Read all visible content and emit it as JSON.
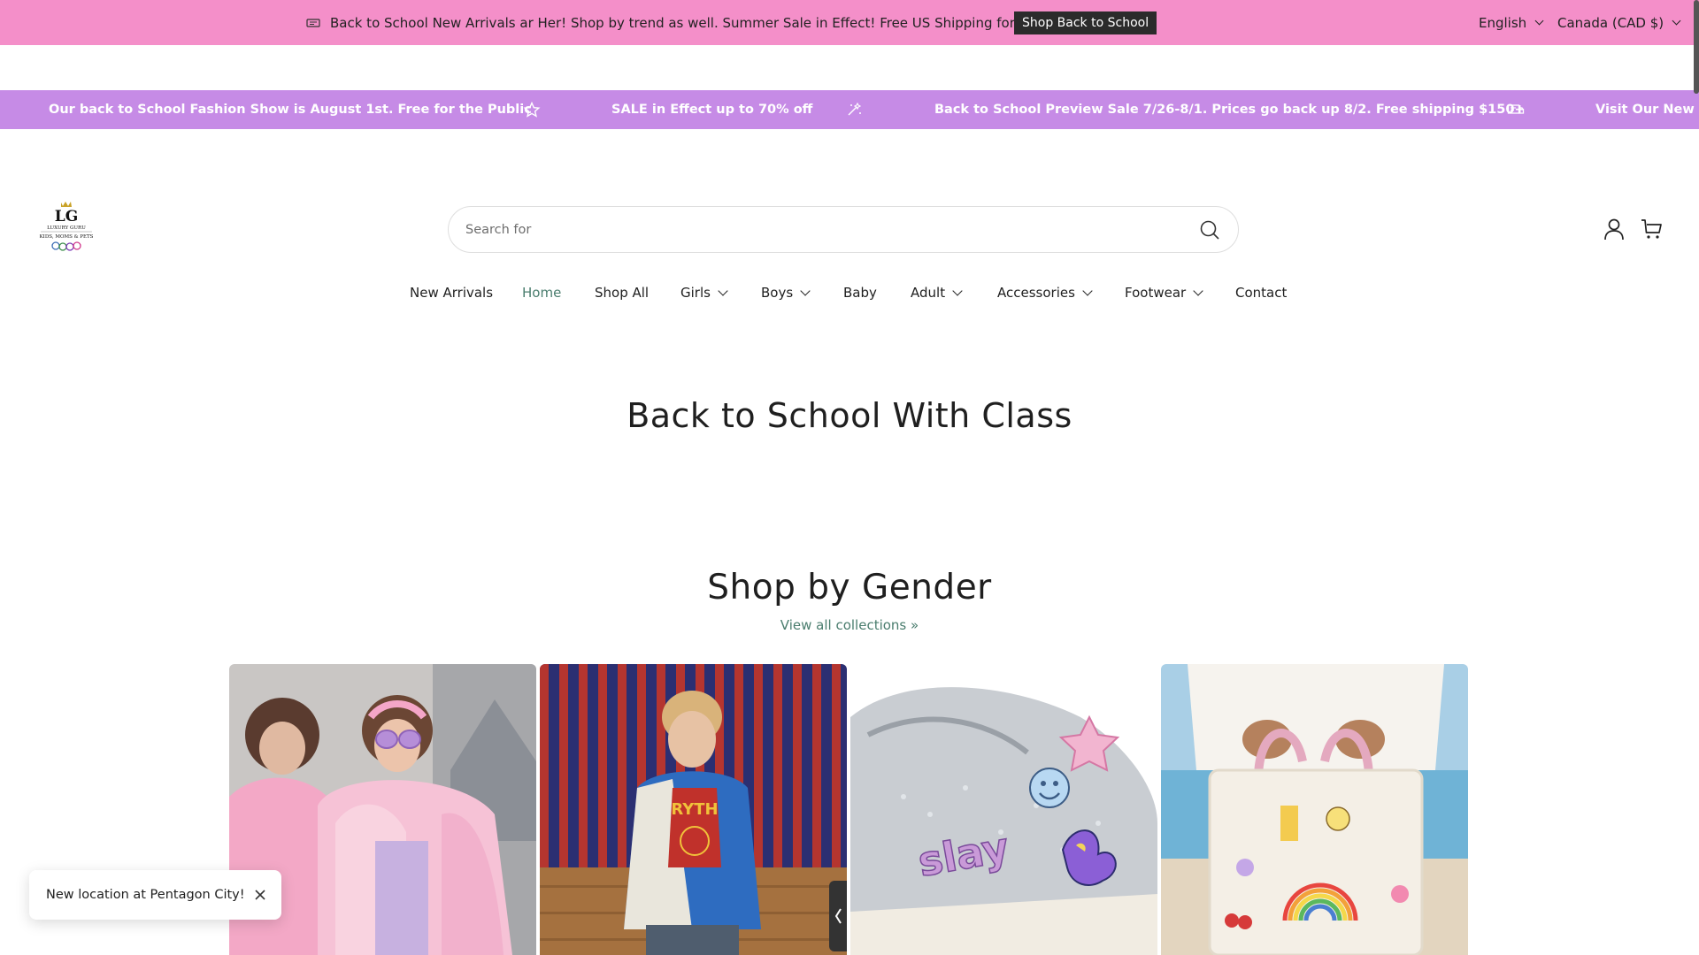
{
  "announcement": {
    "message": "Back to School New Arrivals ar Her! Shop by trend as well. Summer Sale in Effect! Free US Shipping for August!!",
    "button_label": "Shop Back to School",
    "language": "English",
    "currency": "Canada (CAD $)"
  },
  "marquee": {
    "items": [
      "Our back to School Fashion Show is August 1st. Free for the Public",
      "SALE in Effect up to 70% off",
      "Back to School Preview Sale 7/26-8/1. Prices go back up 8/2. Free shipping $150+",
      "Visit Our New Lo"
    ],
    "icons": [
      "star-icon",
      "sparkle-icon",
      "truck-icon"
    ]
  },
  "header": {
    "logo_alt": "LG Luxury Guru Kids Moms & Pets",
    "search_placeholder": "Search for"
  },
  "nav": {
    "items": [
      {
        "label": "New Arrivals",
        "dropdown": false
      },
      {
        "label": "Home",
        "dropdown": false,
        "active": true
      },
      {
        "label": "Shop All",
        "dropdown": false
      },
      {
        "label": "Girls",
        "dropdown": true
      },
      {
        "label": "Boys",
        "dropdown": true
      },
      {
        "label": "Baby",
        "dropdown": false
      },
      {
        "label": "Adult",
        "dropdown": true
      },
      {
        "label": "Accessories",
        "dropdown": true
      },
      {
        "label": "Footwear",
        "dropdown": true
      },
      {
        "label": "Contact",
        "dropdown": false
      }
    ]
  },
  "hero": {
    "title": "Back to School With Class"
  },
  "collections": {
    "title": "Shop by Gender",
    "view_all": "View all collections »"
  },
  "toast": {
    "message": "New location at Pentagon City!"
  },
  "colors": {
    "announcement_bg": "#f48fc9",
    "marquee_bg": "#c68be6",
    "accent_green": "#4a7d6e",
    "button_dark": "#2b2b2b"
  }
}
